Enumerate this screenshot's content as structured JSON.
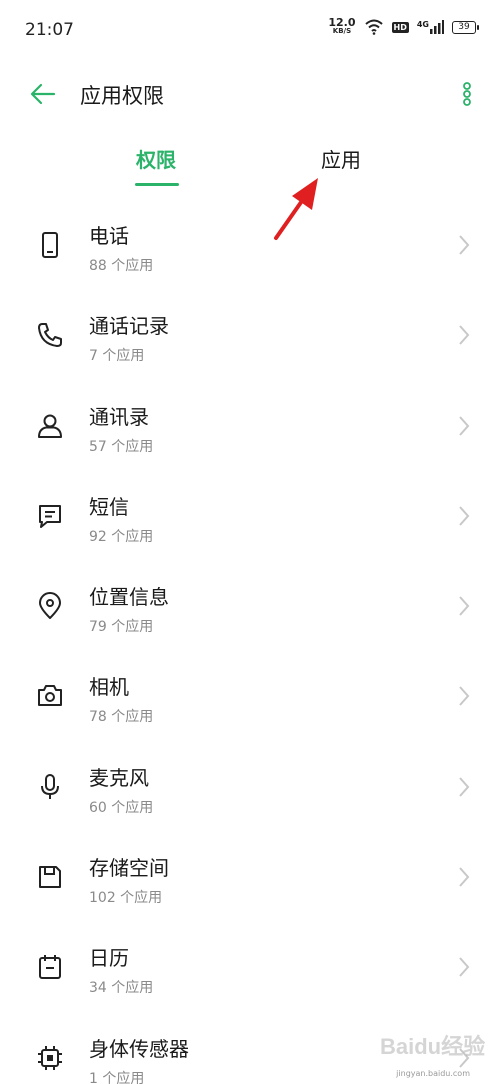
{
  "status_bar": {
    "time": "21:07",
    "speed_value": "12.0",
    "speed_unit": "KB/S",
    "hd": "HD",
    "network": "4G",
    "battery": "39"
  },
  "header": {
    "title": "应用权限"
  },
  "tabs": [
    {
      "label": "权限",
      "active": true
    },
    {
      "label": "应用",
      "active": false
    }
  ],
  "accent_color": "#2bb36a",
  "permissions": [
    {
      "name": "电话",
      "count": "88 个应用",
      "icon": "phone-icon"
    },
    {
      "name": "通话记录",
      "count": "7 个应用",
      "icon": "call-log-icon"
    },
    {
      "name": "通讯录",
      "count": "57 个应用",
      "icon": "contacts-icon"
    },
    {
      "name": "短信",
      "count": "92 个应用",
      "icon": "sms-icon"
    },
    {
      "name": "位置信息",
      "count": "79 个应用",
      "icon": "location-icon"
    },
    {
      "name": "相机",
      "count": "78 个应用",
      "icon": "camera-icon"
    },
    {
      "name": "麦克风",
      "count": "60 个应用",
      "icon": "microphone-icon"
    },
    {
      "name": "存储空间",
      "count": "102 个应用",
      "icon": "storage-icon"
    },
    {
      "name": "日历",
      "count": "34 个应用",
      "icon": "calendar-icon"
    },
    {
      "name": "身体传感器",
      "count": "1 个应用",
      "icon": "body-sensor-icon"
    }
  ],
  "watermark": {
    "text": "Baidu经验",
    "url": "jingyan.baidu.com"
  }
}
